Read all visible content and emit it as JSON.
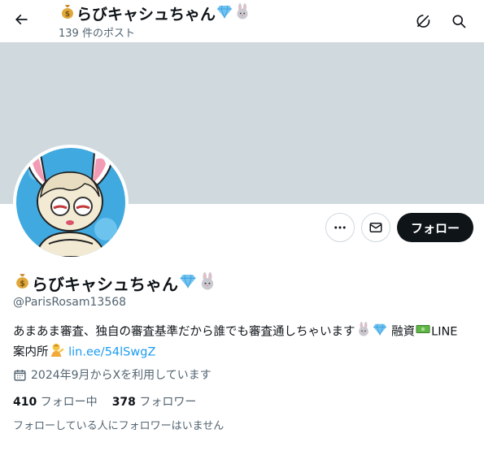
{
  "header": {
    "title": "らびキャシュちゃん",
    "post_count": "139 件のポスト",
    "back_icon": "arrow-left-icon",
    "grok_icon": "grok-icon",
    "search_icon": "search-icon"
  },
  "banner": {
    "color": "#cfd9de"
  },
  "profile": {
    "display_name": "らびキャシュちゃん",
    "handle": "@ParisRosam13568",
    "bio_text": "あまあま審査、独自の審査基準だから誰でも審査通しちゃいます",
    "bio_finance": "融資",
    "bio_line": "LINE",
    "bio_line2": "案内所",
    "bio_link": "lin.ee/54lSwgZ",
    "joined": "2024年9月からXを利用しています",
    "following_count": "410",
    "following_label": "フォロー中",
    "followers_count": "378",
    "followers_label": "フォロワー",
    "followers_you_know": "フォローしている人にフォロワーはいません"
  },
  "actions": {
    "more_icon": "more-icon",
    "message_icon": "mail-icon",
    "follow_label": "フォロー"
  },
  "colors": {
    "accent_link": "#1d9bf0",
    "follow_bg": "#0f1419",
    "secondary_text": "#536471"
  }
}
